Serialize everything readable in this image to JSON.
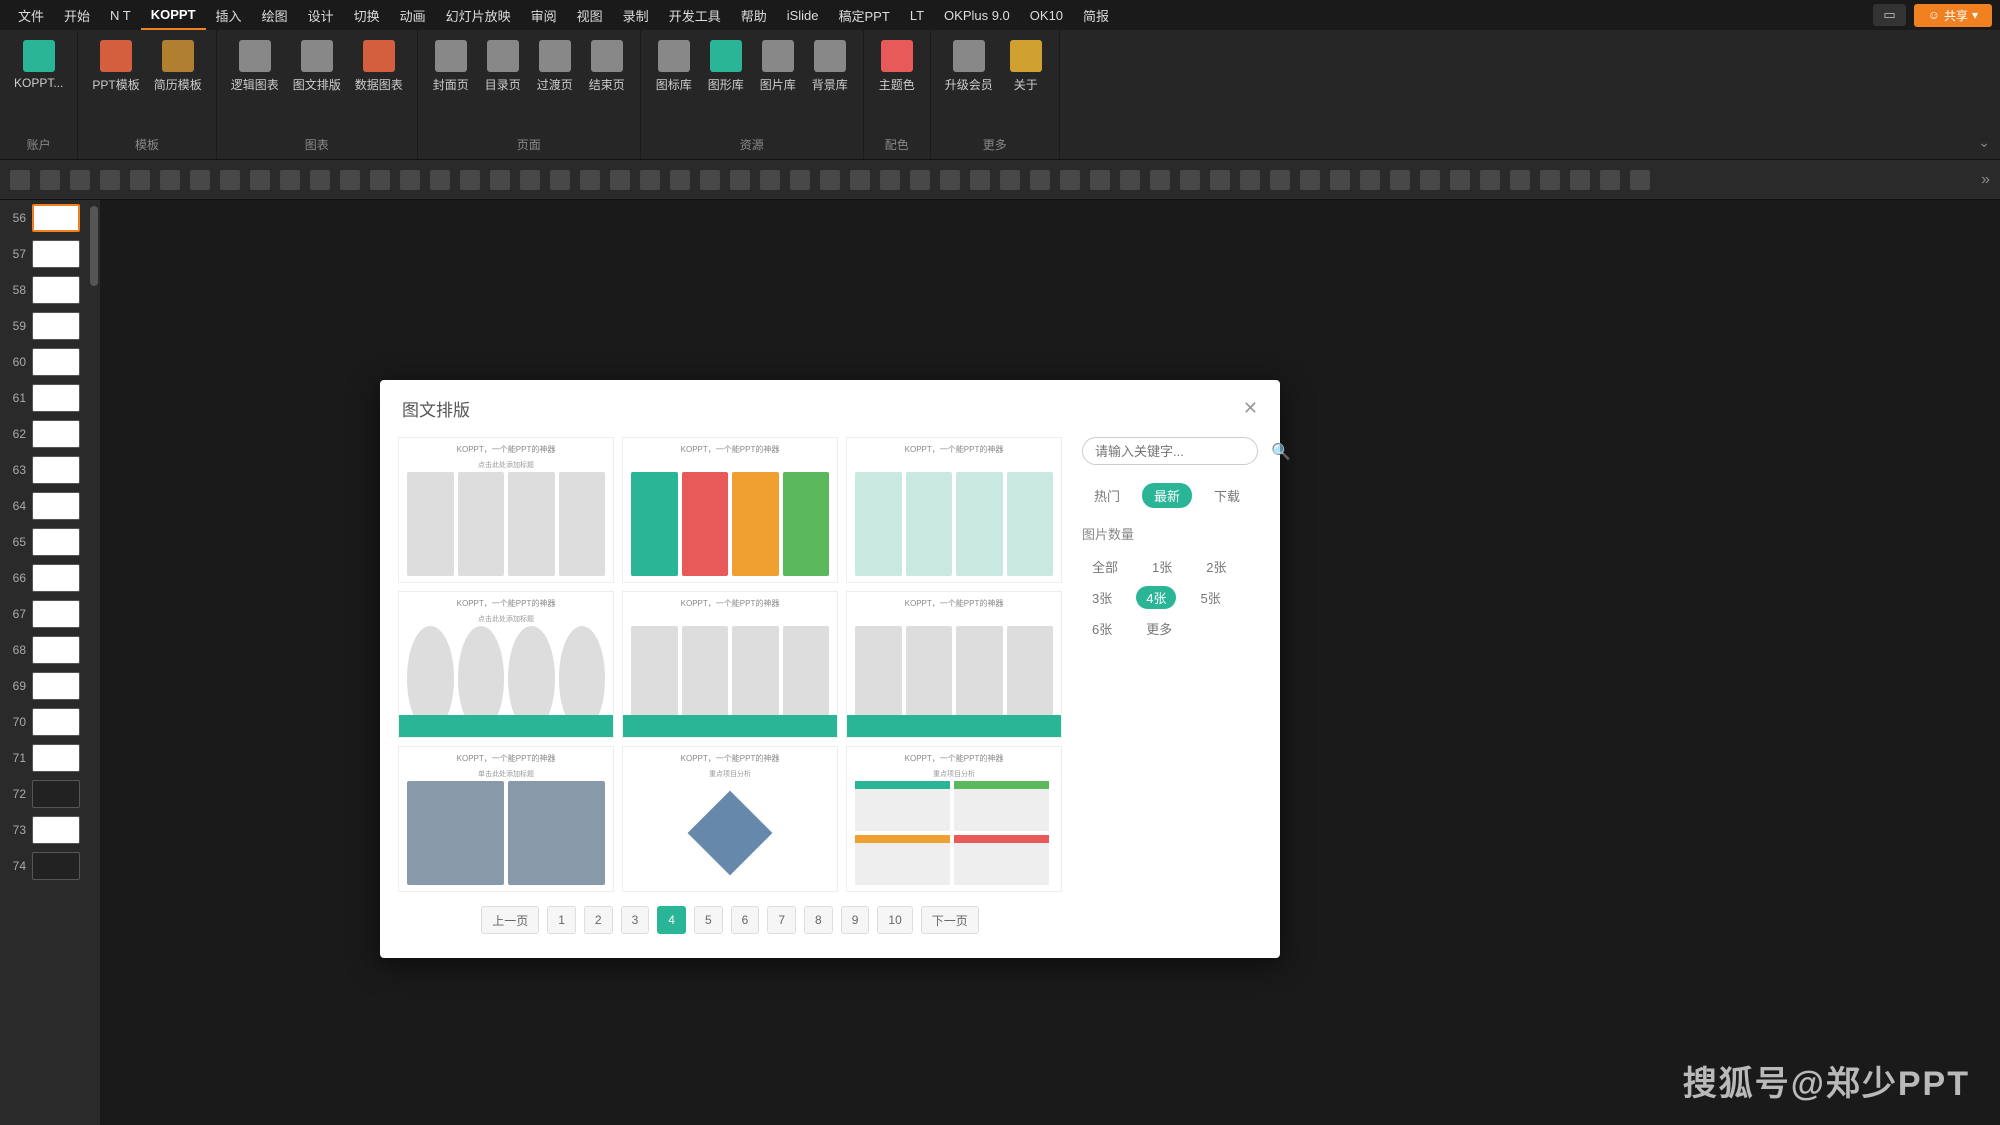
{
  "menubar": {
    "items": [
      "文件",
      "开始",
      "N T",
      "KOPPT",
      "插入",
      "绘图",
      "设计",
      "切换",
      "动画",
      "幻灯片放映",
      "审阅",
      "视图",
      "录制",
      "开发工具",
      "帮助",
      "iSlide",
      "稿定PPT",
      "LT",
      "OKPlus 9.0",
      "OK10",
      "简报"
    ],
    "active_index": 3,
    "share": "共享"
  },
  "ribbon": {
    "groups": [
      {
        "label": "账户",
        "buttons": [
          {
            "label": "KOPPT...",
            "icon": "koppt-logo",
            "color": "#29b596"
          }
        ]
      },
      {
        "label": "模板",
        "buttons": [
          {
            "label": "PPT模板",
            "icon": "ppt-tpl",
            "color": "#d35f3f"
          },
          {
            "label": "简历模板",
            "icon": "resume-tpl",
            "color": "#b08030"
          }
        ]
      },
      {
        "label": "图表",
        "buttons": [
          {
            "label": "逻辑图表",
            "icon": "logic-chart",
            "color": "#888"
          },
          {
            "label": "图文排版",
            "icon": "img-layout",
            "color": "#888"
          },
          {
            "label": "数据图表",
            "icon": "data-chart",
            "color": "#d35f3f"
          }
        ]
      },
      {
        "label": "页面",
        "buttons": [
          {
            "label": "封面页",
            "icon": "cover",
            "color": "#888"
          },
          {
            "label": "目录页",
            "icon": "toc",
            "color": "#888"
          },
          {
            "label": "过渡页",
            "icon": "transition",
            "color": "#888"
          },
          {
            "label": "结束页",
            "icon": "end",
            "color": "#888"
          }
        ]
      },
      {
        "label": "资源",
        "buttons": [
          {
            "label": "图标库",
            "icon": "icon-lib",
            "color": "#888"
          },
          {
            "label": "图形库",
            "icon": "shape-lib",
            "color": "#29b596"
          },
          {
            "label": "图片库",
            "icon": "image-lib",
            "color": "#888"
          },
          {
            "label": "背景库",
            "icon": "bg-lib",
            "color": "#888"
          }
        ]
      },
      {
        "label": "配色",
        "buttons": [
          {
            "label": "主题色",
            "icon": "theme-color",
            "color": "#e85a5a"
          }
        ]
      },
      {
        "label": "更多",
        "buttons": [
          {
            "label": "升级会员",
            "icon": "upgrade",
            "color": "#888"
          },
          {
            "label": "关于",
            "icon": "about",
            "color": "#d0a030"
          }
        ]
      }
    ]
  },
  "slides": {
    "start": 56,
    "count": 19,
    "selected": 56
  },
  "modal": {
    "title": "图文排版",
    "search_placeholder": "请输入关键字...",
    "sort_tabs": [
      "热门",
      "最新",
      "下载"
    ],
    "sort_active": 1,
    "count_label": "图片数量",
    "counts": [
      "全部",
      "1张",
      "2张",
      "3张",
      "4张",
      "5张",
      "6张",
      "更多"
    ],
    "count_active": 4,
    "tpl_header": "KOPPT，一个能PPT的神器",
    "tpl_sub1": "点击此处添加标题",
    "tpl_sub2": "单击此处添加标题",
    "tpl_sub3": "重点项目分析",
    "pagination": {
      "prev": "上一页",
      "next": "下一页",
      "pages": [
        "1",
        "2",
        "3",
        "4",
        "5",
        "6",
        "7",
        "8",
        "9",
        "10"
      ],
      "active": 3
    }
  },
  "watermark": "搜狐号@郑少PPT"
}
